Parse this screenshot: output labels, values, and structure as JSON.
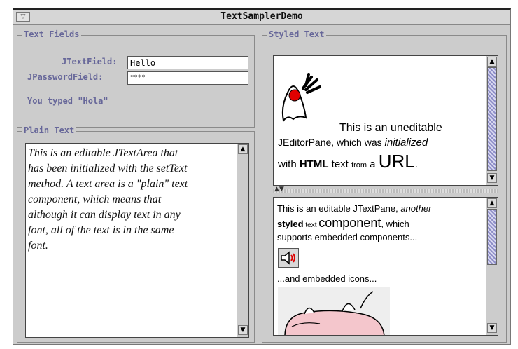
{
  "window": {
    "title": "TextSamplerDemo",
    "menu_glyph": "▽"
  },
  "text_fields": {
    "section_title": "Text Fields",
    "jtextfield_label": "JTextField:",
    "jtextfield_value": "Hello",
    "jpasswordfield_label": "JPasswordField:",
    "jpasswordfield_value": "****",
    "you_typed": "You typed \"Hola\""
  },
  "plain_text": {
    "section_title": "Plain Text",
    "lines": [
      "This is an editable JTextArea that",
      "has been initialized with the setText",
      "method. A text area is a \"plain\" text",
      "component, which means that",
      "although it can display text in any",
      "font, all of the text is in the same",
      "font."
    ]
  },
  "styled_text": {
    "section_title": "Styled Text",
    "editor_pane": {
      "line1": "This is an uneditable",
      "line2_a": "JEditorPane, which was ",
      "line2_b": "initialized",
      "line3_a": "with ",
      "line3_b": "HTML",
      "line3_c": " text ",
      "line3_d": "from",
      "line3_e": " a ",
      "line3_f": "URL",
      "line3_g": "."
    },
    "text_pane": {
      "line1_a": "This is an editable JTextPane, ",
      "line1_b": "another",
      "line2_a": "styled",
      "line2_b": " text ",
      "line2_c": "component",
      "line2_d": ", which",
      "line3": "supports embedded components...",
      "line4": "...and embedded icons..."
    }
  },
  "icons": {
    "duke": "duke-mascot-icon",
    "sound": "speaker-icon",
    "pig": "pig-image-icon"
  }
}
